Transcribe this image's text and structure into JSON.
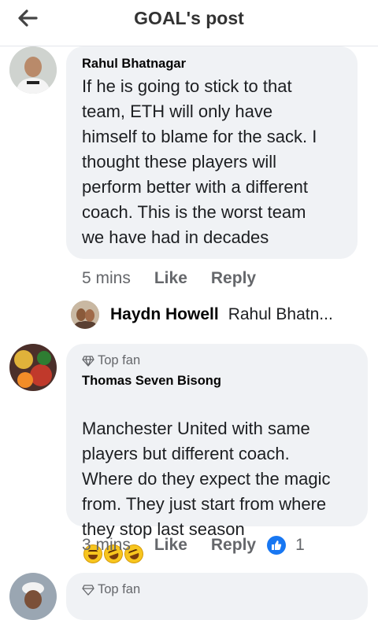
{
  "header": {
    "title": "GOAL's post",
    "back_icon": "arrow-left-icon"
  },
  "comments": [
    {
      "author": "Rahul Bhatnagar",
      "text": "If he is going to stick to that\nteam, ETH will only have\nhimself to blame for the sack. I\nthought these players will\nperform better with a different\ncoach. This is the worst team\nwe have had in decades",
      "time": "5 mins",
      "like_label": "Like",
      "reply_label": "Reply"
    },
    {
      "badge": "Top fan",
      "author": "Thomas Seven Bisong",
      "text": "Manchester United with same\nplayers but different coach.\nWhere do they expect the magic\nfrom. They just start from where\nthey stop last season",
      "emojis": [
        "grinning-squinting-face-icon",
        "rolling-on-floor-laughing-icon",
        "rolling-on-floor-laughing-icon"
      ],
      "time": "3 mins",
      "like_label": "Like",
      "reply_label": "Reply",
      "reaction_count": "1",
      "reaction_icon": "like-reaction-icon"
    }
  ],
  "reply_preview": {
    "author": "Haydn Howell",
    "text": "Rahul Bhatn..."
  },
  "next_comment": {
    "badge": "Top fan"
  },
  "colors": {
    "bubble": "#f0f2f5",
    "muted": "#65676b",
    "like_blue": "#1877f2"
  }
}
